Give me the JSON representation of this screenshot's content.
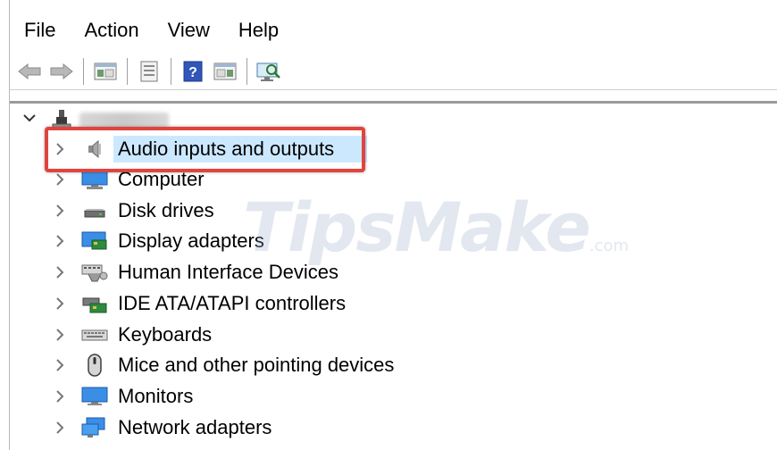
{
  "menu": [
    {
      "label": "File"
    },
    {
      "label": "Action"
    },
    {
      "label": "View"
    },
    {
      "label": "Help"
    }
  ],
  "toolbar": {
    "buttons": [
      "back-icon",
      "forward-icon",
      "show-hide-console-tree-icon",
      "properties-icon",
      "help-icon",
      "action-pane-icon",
      "scan-hardware-icon"
    ]
  },
  "tree": {
    "root": {
      "expanded": true,
      "icon": "computer-root-icon"
    },
    "categories": [
      {
        "label": "Audio inputs and outputs",
        "icon": "speaker-icon",
        "selected": true
      },
      {
        "label": "Computer",
        "icon": "computer-icon"
      },
      {
        "label": "Disk drives",
        "icon": "disk-drive-icon"
      },
      {
        "label": "Display adapters",
        "icon": "display-adapter-icon"
      },
      {
        "label": "Human Interface Devices",
        "icon": "hid-icon"
      },
      {
        "label": "IDE ATA/ATAPI controllers",
        "icon": "ide-controller-icon"
      },
      {
        "label": "Keyboards",
        "icon": "keyboard-icon"
      },
      {
        "label": "Mice and other pointing devices",
        "icon": "mouse-icon"
      },
      {
        "label": "Monitors",
        "icon": "monitor-icon"
      },
      {
        "label": "Network adapters",
        "icon": "network-adapter-icon"
      }
    ]
  },
  "annotation_color": "#e0443e",
  "selection_color": "#cce8ff",
  "watermark": {
    "main": "TipsMake",
    "suffix": ".com"
  }
}
